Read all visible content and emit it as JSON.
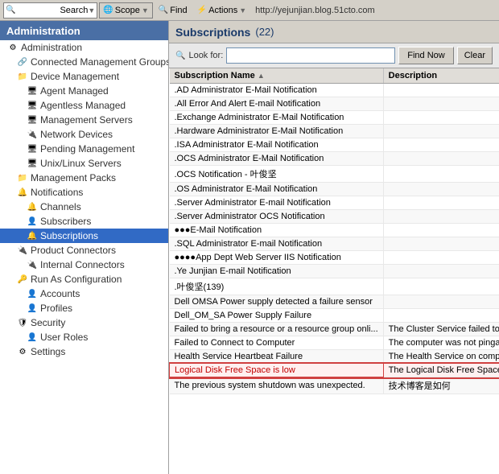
{
  "toolbar": {
    "search_placeholder": "",
    "search_label": "Search",
    "scope_label": "Scope",
    "find_label": "Find",
    "actions_label": "Actions",
    "url": "http://yejunjian.blog.51cto.com"
  },
  "sidebar": {
    "title": "Administration",
    "items": [
      {
        "id": "administration",
        "label": "Administration",
        "level": 1,
        "icon": "gear",
        "expanded": true
      },
      {
        "id": "connected-groups",
        "label": "Connected Management Groups",
        "level": 2,
        "icon": "group"
      },
      {
        "id": "device-management",
        "label": "Device Management",
        "level": 2,
        "icon": "folder",
        "expanded": true
      },
      {
        "id": "agent-managed",
        "label": "Agent Managed",
        "level": 3,
        "icon": "server"
      },
      {
        "id": "agentless-managed",
        "label": "Agentless Managed",
        "level": 3,
        "icon": "server"
      },
      {
        "id": "management-servers",
        "label": "Management Servers",
        "level": 3,
        "icon": "server"
      },
      {
        "id": "network-devices",
        "label": "Network Devices",
        "level": 3,
        "icon": "plug"
      },
      {
        "id": "pending-management",
        "label": "Pending Management",
        "level": 3,
        "icon": "server"
      },
      {
        "id": "unix-linux-servers",
        "label": "Unix/Linux Servers",
        "level": 3,
        "icon": "server"
      },
      {
        "id": "management-packs",
        "label": "Management Packs",
        "level": 2,
        "icon": "folder"
      },
      {
        "id": "notifications",
        "label": "Notifications",
        "level": 2,
        "icon": "bell",
        "expanded": true
      },
      {
        "id": "channels",
        "label": "Channels",
        "level": 3,
        "icon": "bell"
      },
      {
        "id": "subscribers",
        "label": "Subscribers",
        "level": 3,
        "icon": "user"
      },
      {
        "id": "subscriptions",
        "label": "Subscriptions",
        "level": 3,
        "icon": "bell",
        "selected": true
      },
      {
        "id": "product-connectors",
        "label": "Product Connectors",
        "level": 2,
        "icon": "plug",
        "expanded": true
      },
      {
        "id": "internal-connectors",
        "label": "Internal Connectors",
        "level": 3,
        "icon": "plug"
      },
      {
        "id": "run-as-configuration",
        "label": "Run As Configuration",
        "level": 2,
        "icon": "key",
        "expanded": true
      },
      {
        "id": "accounts",
        "label": "Accounts",
        "level": 3,
        "icon": "user"
      },
      {
        "id": "profiles",
        "label": "Profiles",
        "level": 3,
        "icon": "user"
      },
      {
        "id": "security",
        "label": "Security",
        "level": 2,
        "icon": "shield",
        "expanded": true
      },
      {
        "id": "user-roles",
        "label": "User Roles",
        "level": 3,
        "icon": "user"
      },
      {
        "id": "settings",
        "label": "Settings",
        "level": 2,
        "icon": "cog"
      }
    ]
  },
  "content": {
    "title": "Subscriptions",
    "count": "(22)",
    "search": {
      "look_for_label": "Look for:",
      "placeholder": "",
      "find_now_label": "Find Now",
      "clear_label": "Clear"
    },
    "table": {
      "columns": [
        {
          "id": "name",
          "label": "Subscription Name",
          "sort": "asc"
        },
        {
          "id": "desc",
          "label": "Description"
        }
      ],
      "rows": [
        {
          "name": ".AD Administrator E-Mail Notification",
          "desc": "",
          "highlighted": false
        },
        {
          "name": ".All Error And Alert E-mail Notification",
          "desc": "",
          "highlighted": false
        },
        {
          "name": ".Exchange Administrator E-Mail Notification",
          "desc": "",
          "highlighted": false
        },
        {
          "name": ".Hardware Administrator E-Mail Notification",
          "desc": "",
          "highlighted": false
        },
        {
          "name": ".ISA Administrator E-Mail Notification",
          "desc": "",
          "highlighted": false
        },
        {
          "name": ".OCS Administrator E-Mail Notification",
          "desc": "",
          "highlighted": false
        },
        {
          "name": ".OCS Notification - 叶俊坚",
          "desc": "",
          "highlighted": false
        },
        {
          "name": ".OS Administrator E-Mail Notification",
          "desc": "",
          "highlighted": false
        },
        {
          "name": ".Server Administrator E-mail Notification",
          "desc": "",
          "highlighted": false
        },
        {
          "name": ".Server Administrator OCS Notification",
          "desc": "",
          "highlighted": false
        },
        {
          "name": "●●●E-Mail Notification",
          "desc": "",
          "highlighted": false
        },
        {
          "name": ".SQL Administrator E-mail Notification",
          "desc": "",
          "highlighted": false
        },
        {
          "name": "●●●●App Dept Web Server IIS Notification",
          "desc": "",
          "highlighted": false
        },
        {
          "name": ".Ye Junjian E-mail Notification",
          "desc": "",
          "highlighted": false
        },
        {
          "name": ".叶俊坚(139)",
          "desc": "",
          "highlighted": false
        },
        {
          "name": "Dell OMSA Power supply detected a failure sensor",
          "desc": "",
          "highlighted": false
        },
        {
          "name": "Dell_OM_SA Power Supply Failure",
          "desc": "",
          "highlighted": false
        },
        {
          "name": "Failed to bring a resource or a resource group onli...",
          "desc": "The Cluster Service failed to b",
          "highlighted": false
        },
        {
          "name": "Failed to Connect to Computer",
          "desc": "The computer was not pingab",
          "highlighted": false
        },
        {
          "name": "Health Service Heartbeat Failure",
          "desc": "The Health Service on compu",
          "highlighted": false
        },
        {
          "name": "Logical Disk Free Space is low",
          "desc": "The Logical Disk Free Space...",
          "highlighted": true
        },
        {
          "name": "The previous system shutdown was unexpected.",
          "desc": "技术博客是如何",
          "highlighted": false
        }
      ]
    }
  }
}
